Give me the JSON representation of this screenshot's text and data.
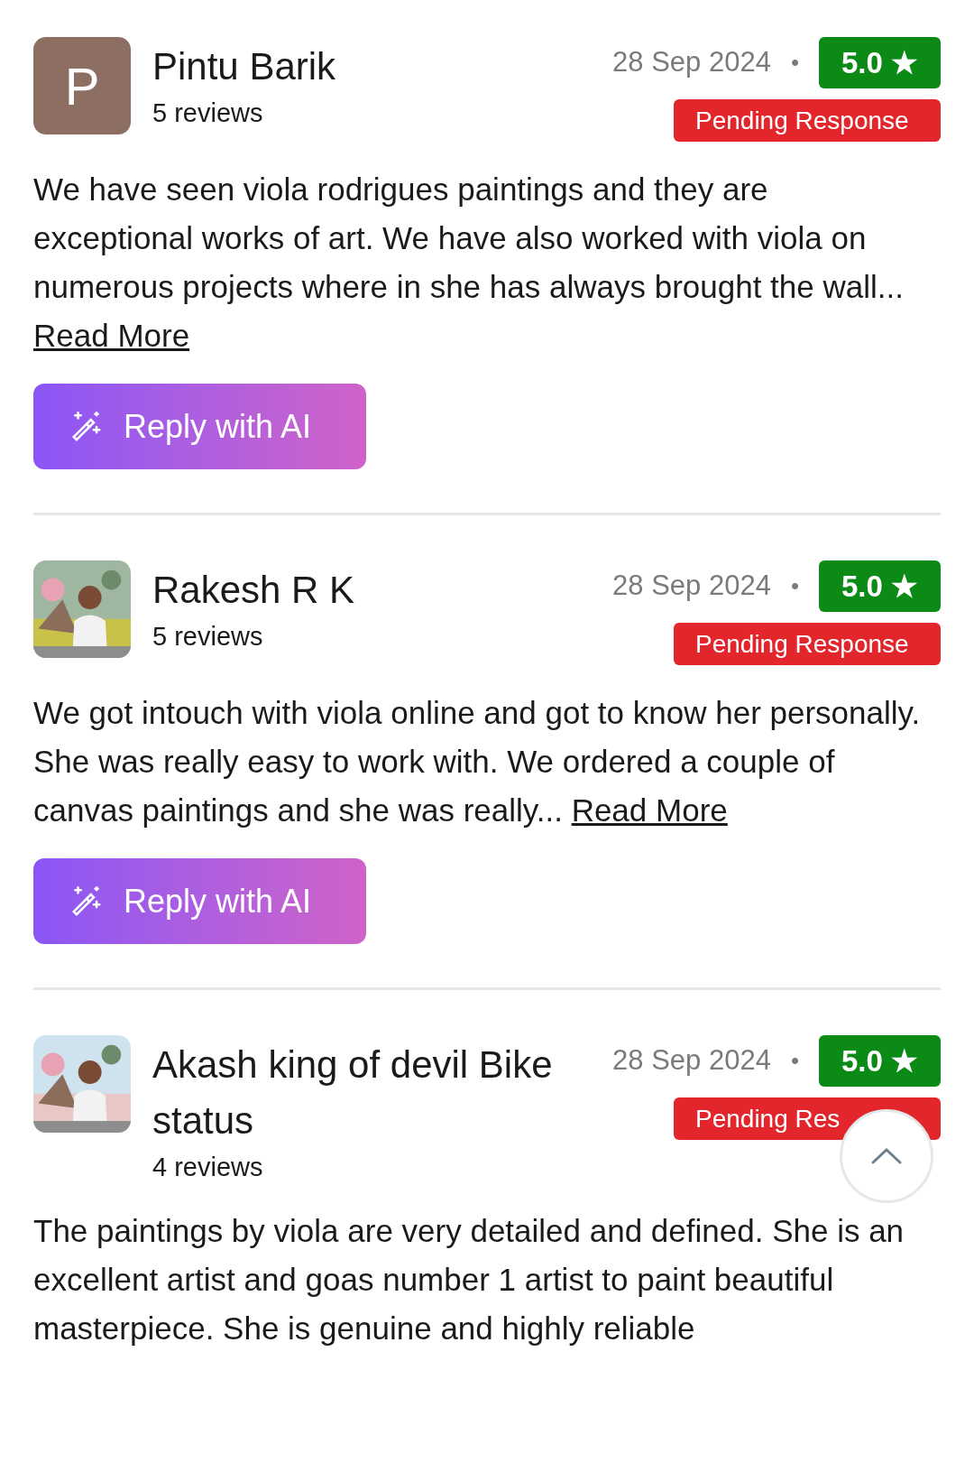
{
  "reviews": [
    {
      "avatar": {
        "kind": "letter",
        "letter": "P"
      },
      "name": "Pintu Barik",
      "review_count": "5 reviews",
      "date": "28 Sep 2024",
      "separator": "•",
      "rating": "5.0 ★",
      "status": "Pending Response",
      "text": "We have seen viola rodrigues paintings and they are exceptional works of art. We have also worked with viola on numerous projects where in she has always brought the wall...",
      "read_more": "Read More",
      "button": "Reply with AI"
    },
    {
      "name": "Rakesh R K",
      "review_count": "5 reviews",
      "date": "28 Sep 2024",
      "separator": "•",
      "rating": "5.0 ★",
      "status": "Pending Response",
      "text": "We got intouch with viola online and got to know her personally. She was really easy to work with. We ordered a couple of canvas paintings and she was really...",
      "read_more": "Read More",
      "button": "Reply with AI"
    },
    {
      "name": "Akash king of devil Bike status",
      "review_count": "4 reviews",
      "date": "28 Sep 2024",
      "separator": "•",
      "rating": "5.0 ★",
      "status": "Pending Res",
      "text": "The paintings by viola are very detailed and defined. She is an excellent artist and goas number 1 artist to paint beautiful masterpiece. She is genuine and highly reliable"
    }
  ],
  "scroll_top_button": {
    "kind": "up"
  }
}
